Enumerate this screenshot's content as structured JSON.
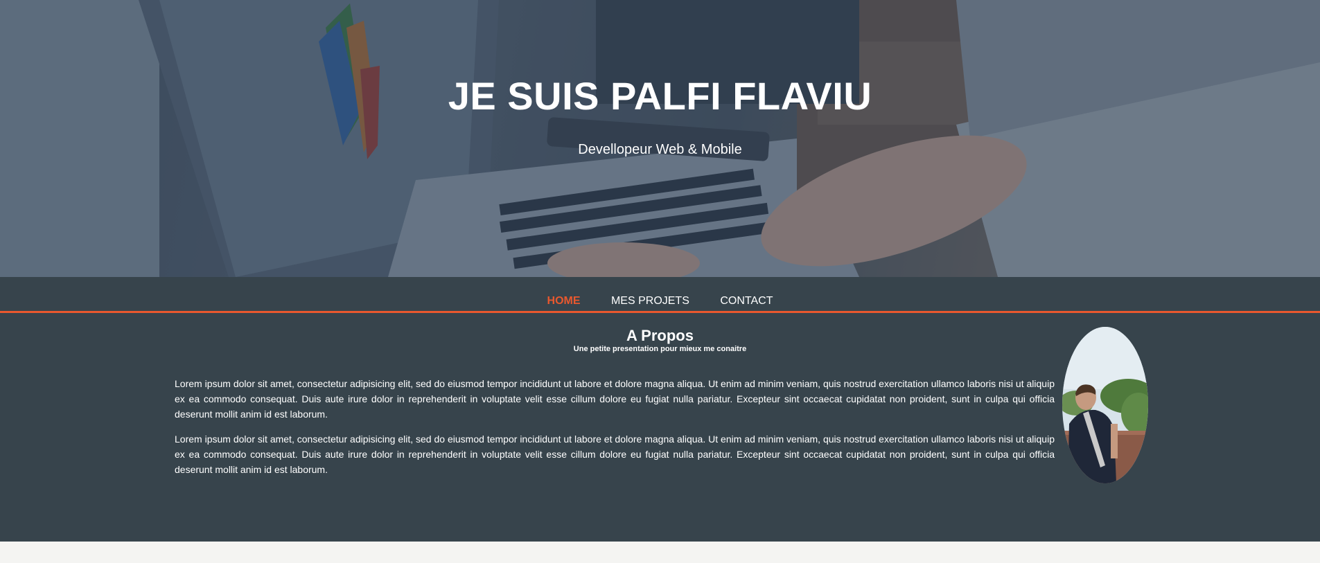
{
  "hero": {
    "title": "JE SUIS PALFI FLAVIU",
    "subtitle": "Devellopeur Web & Mobile",
    "background_image": "laptop-keyboard-hands-photo"
  },
  "nav": {
    "items": [
      {
        "label": "HOME",
        "active": true
      },
      {
        "label": "MES PROJETS",
        "active": false
      },
      {
        "label": "CONTACT",
        "active": false
      }
    ],
    "accent_color": "#e9582e"
  },
  "about": {
    "title": "A Propos",
    "subtitle": "Une petite presentation pour mieux me conaitre",
    "paragraphs": [
      "Lorem ipsum dolor sit amet, consectetur adipisicing elit, sed do eiusmod tempor incididunt ut labore et dolore magna aliqua. Ut enim ad minim veniam, quis nostrud exercitation ullamco laboris nisi ut aliquip ex ea commodo consequat. Duis aute irure dolor in reprehenderit in voluptate velit esse cillum dolore eu fugiat nulla pariatur. Excepteur sint occaecat cupidatat non proident, sunt in culpa qui officia deserunt mollit anim id est laborum.",
      "Lorem ipsum dolor sit amet, consectetur adipisicing elit, sed do eiusmod tempor incididunt ut labore et dolore magna aliqua. Ut enim ad minim veniam, quis nostrud exercitation ullamco laboris nisi ut aliquip ex ea commodo consequat. Duis aute irure dolor in reprehenderit in voluptate velit esse cillum dolore eu fugiat nulla pariatur. Excepteur sint occaecat cupidatat non proident, sunt in culpa qui officia deserunt mollit anim id est laborum."
    ],
    "photo": "profile-photo"
  },
  "colors": {
    "section_bg": "#37444c",
    "page_bg": "#f4f4f2",
    "text": "#ffffff"
  }
}
